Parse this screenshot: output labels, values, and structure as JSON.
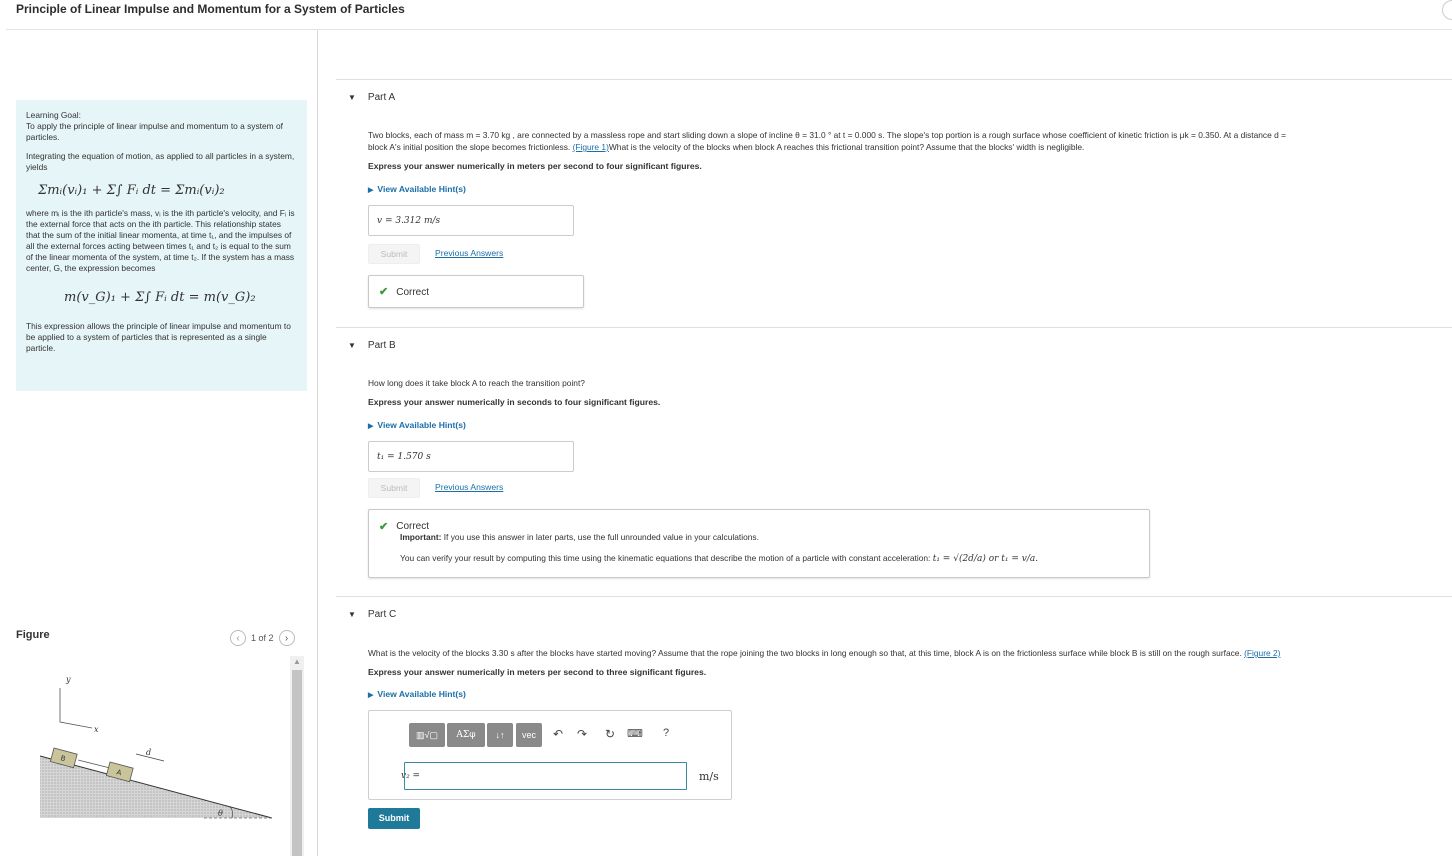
{
  "page": {
    "title": "Principle of Linear Impulse and Momentum for a System of Particles"
  },
  "learning_goal": {
    "heading": "Learning Goal:",
    "intro": "To apply the principle of linear impulse and momentum to a system of particles.",
    "p2": "Integrating the equation of motion, as applied to all particles in a system, yields",
    "eq1": "Σmᵢ(vᵢ)₁ + Σ∫ Fᵢ dt = Σmᵢ(vᵢ)₂",
    "p3": "where mᵢ is the ith particle's mass, vᵢ is the ith particle's velocity, and Fᵢ is the external force that acts on the ith particle. This relationship states that the sum of the initial linear momenta, at time t₁, and the impulses of all the external forces acting between times t₁ and t₂ is equal to the sum of the linear momenta of the system, at time t₂. If the system has a mass center, G, the expression becomes",
    "eq2": "m(v_G)₁ + Σ∫ Fᵢ dt = m(v_G)₂",
    "p4": "This expression allows the principle of linear impulse and momentum to be applied to a system of particles that is represented as a single particle."
  },
  "figure": {
    "label": "Figure",
    "pager": "1 of 2",
    "prev_icon": "chevron-left-icon",
    "next_icon": "chevron-right-icon",
    "axis_y": "y",
    "axis_x": "x",
    "block_b": "B",
    "block_a": "A",
    "dim_d": "d",
    "angle": "θ"
  },
  "part_a": {
    "title": "Part A",
    "problem_line1": "Two blocks, each of mass m = 3.70 kg , are connected by a massless rope and start sliding down a slope of incline θ = 31.0 ° at t = 0.000 s. The slope's top portion is a rough surface whose coefficient of kinetic friction is μk = 0.350. At a distance d =",
    "problem_line2_pre": "block A's initial position the slope becomes frictionless. ",
    "figure_link": "(Figure 1)",
    "problem_line2_post": "What is the velocity of the blocks when block A reaches this frictional transition point? Assume that the blocks' width is negligible.",
    "instruction": "Express your answer numerically in meters per second to four significant figures.",
    "hint": "View Available Hint(s)",
    "answer": "v = 3.312 m/s",
    "submit": "Submit",
    "previous": "Previous Answers",
    "result": "Correct"
  },
  "part_b": {
    "title": "Part B",
    "question": "How long does it take block A to reach the transition point?",
    "instruction": "Express your answer numerically in seconds to four significant figures.",
    "hint": "View Available Hint(s)",
    "answer": "t₁ = 1.570 s",
    "submit": "Submit",
    "previous": "Previous Answers",
    "result": "Correct",
    "important_label": "Important:",
    "important": "If you use this answer in later parts, use the full unrounded value in your calculations.",
    "verify_pre": "You can verify your result by computing this time using the kinematic equations that describe the motion of a particle with constant acceleration:",
    "verify_eq": "t₁ = √(2d/a) or t₁ = v/a."
  },
  "part_c": {
    "title": "Part C",
    "question": "What is the velocity of the blocks 3.30 s after the blocks have started moving? Assume that the rope joining the two blocks in long enough so that, at this time, block A is on the frictionless surface while block B is still on the rough surface.",
    "figure_link": "(Figure 2)",
    "instruction": "Express your answer numerically in meters per second to three significant figures.",
    "hint": "View Available Hint(s)",
    "toolbar": {
      "templates": "▥√▢",
      "greek": "ΑΣφ",
      "updown": "↓↑",
      "vec": "vec",
      "undo": "↶",
      "redo": "↷",
      "reset": "↻",
      "keyboard": "⌨",
      "help": "?"
    },
    "var_label": "v₂ =",
    "input_value": "",
    "unit": "m/s",
    "submit": "Submit"
  }
}
